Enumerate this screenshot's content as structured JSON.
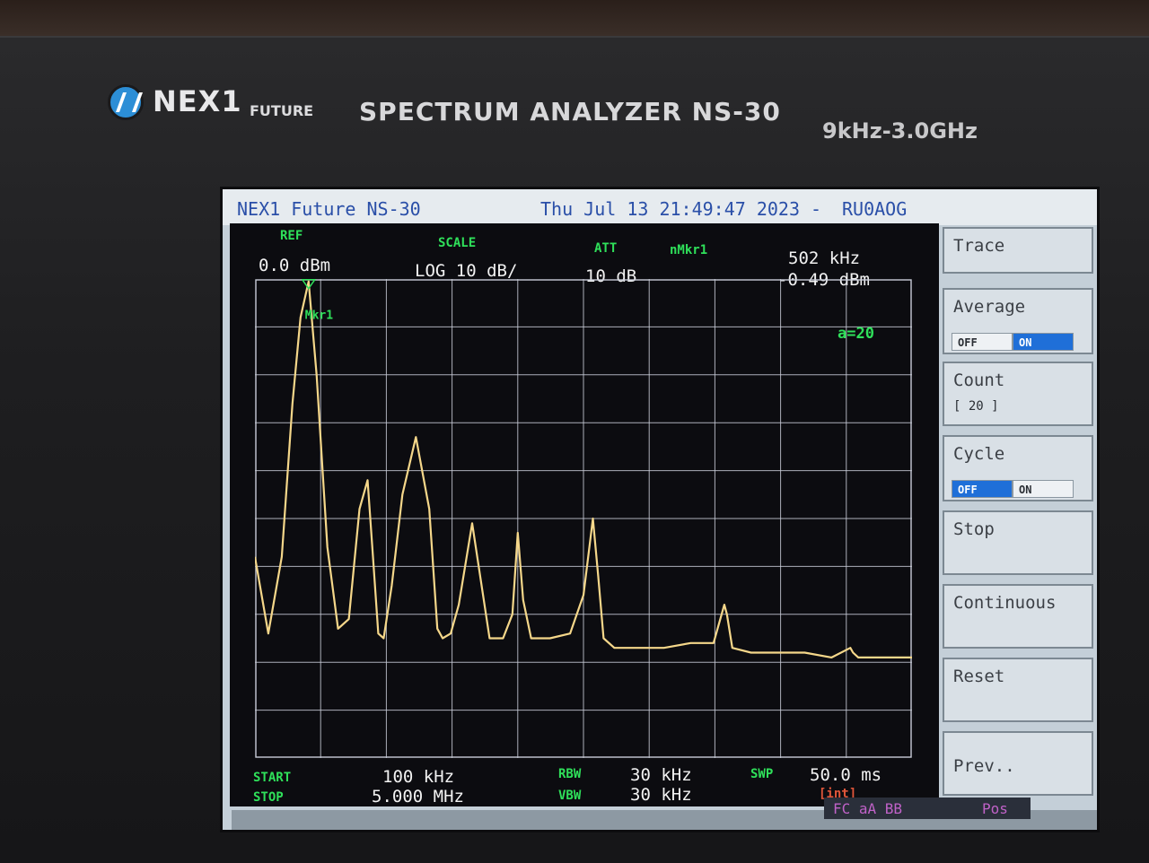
{
  "device": {
    "brand": "NEX1",
    "brand_sub": "FUTURE",
    "model_title": "SPECTRUM ANALYZER NS-30",
    "range": "9kHz-3.0GHz"
  },
  "screen": {
    "title_left": "NEX1 Future NS-30",
    "datetime": "Thu Jul 13 21:49:47 2023 -",
    "callsign": "RU0AOG"
  },
  "header": {
    "ref_label": "REF",
    "ref_value": "0.0 dBm",
    "scale_label": "SCALE",
    "scale_value": "LOG 10 dB/",
    "att_label": "ATT",
    "att_value": "10 dB",
    "marker_label": "nMkr1",
    "marker_freq": "502 kHz",
    "marker_level": "-0.49 dBm",
    "marker_tag": "Mkr1",
    "avg_count": "a=20"
  },
  "footer": {
    "start_label": "START",
    "start_value": "100 kHz",
    "stop_label": "STOP",
    "stop_value": "5.000 MHz",
    "rbw_label": "RBW",
    "rbw_value": "30 kHz",
    "vbw_label": "VBW",
    "vbw_value": "30 kHz",
    "swp_label": "SWP",
    "swp_value": "50.0 ms",
    "swp_mode": "[int]",
    "status_fc": "FC aA BB",
    "status_pos": "Pos"
  },
  "softkeys": {
    "trace": "Trace",
    "average": "Average",
    "average_off": "OFF",
    "average_on": "ON",
    "average_state": "on",
    "count": "Count",
    "count_value": "[ 20 ]",
    "cycle": "Cycle",
    "cycle_off": "OFF",
    "cycle_on": "ON",
    "cycle_state": "off",
    "stop": "Stop",
    "continuous": "Continuous",
    "reset": "Reset",
    "prev": "Prev.."
  },
  "colors": {
    "trace": "#f5d78a",
    "grid": "#c8ccd8",
    "label_green": "#2fe05a",
    "title_blue": "#2a4fa8",
    "status_magenta": "#c062c8",
    "toggle_active": "#1f6fd8"
  },
  "chart_data": {
    "type": "line",
    "x_unit": "MHz",
    "y_unit": "dBm",
    "xlim": [
      0.1,
      5.0
    ],
    "ylim": [
      -100,
      0
    ],
    "x_divisions": 10,
    "y_divisions": 10,
    "grid": true,
    "series": [
      {
        "values_x": [
          0.1,
          0.2,
          0.3,
          0.38,
          0.44,
          0.5,
          0.56,
          0.64,
          0.72,
          0.8,
          0.88,
          0.94,
          0.98,
          1.02,
          1.06,
          1.12,
          1.2,
          1.3,
          1.4,
          1.46,
          1.5,
          1.56,
          1.62,
          1.72,
          1.85,
          1.95,
          2.02,
          2.06,
          2.1,
          2.16,
          2.3,
          2.45,
          2.55,
          2.62,
          2.66,
          2.7,
          2.78,
          2.95,
          3.15,
          3.35,
          3.52,
          3.6,
          3.62,
          3.66,
          3.8,
          4.0,
          4.2,
          4.4,
          4.54,
          4.56,
          4.6,
          4.8,
          5.0
        ],
        "values_y": [
          -58,
          -74,
          -58,
          -26,
          -8,
          -0.5,
          -20,
          -56,
          -73,
          -71,
          -48,
          -42,
          -58,
          -74,
          -75,
          -64,
          -45,
          -33,
          -48,
          -73,
          -75,
          -74,
          -68,
          -51,
          -75,
          -75,
          -70,
          -53,
          -67,
          -75,
          -75,
          -74,
          -66,
          -50,
          -62,
          -75,
          -77,
          -77,
          -77,
          -76,
          -76,
          -68,
          -70,
          -77,
          -78,
          -78,
          -78,
          -79,
          -77,
          -78,
          -79,
          -79,
          -79
        ]
      }
    ]
  }
}
